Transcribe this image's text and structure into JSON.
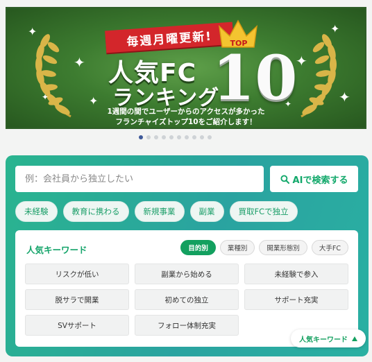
{
  "banner": {
    "ribbon": "毎週月曜更新!",
    "top_label": "TOP",
    "title_line1": "人気FC",
    "title_line2": "ランキング",
    "number": "10",
    "desc_line1": "1週間の間でユーザーからのアクセスが多かった",
    "desc_line2": "フランチャイズトップ10をご紹介します！"
  },
  "carousel": {
    "total": 10,
    "active_index": 0
  },
  "search": {
    "placeholder": "例：会社員から独立したい",
    "button_label": "AIで検索する"
  },
  "quick_tags": [
    "未経験",
    "教育に携わる",
    "新規事業",
    "副業",
    "買取FCで独立"
  ],
  "keywords": {
    "title": "人気キーワード",
    "tabs": [
      {
        "label": "目的別",
        "active": true
      },
      {
        "label": "業種別",
        "active": false
      },
      {
        "label": "開業形態別",
        "active": false
      },
      {
        "label": "大手FC",
        "active": false
      }
    ],
    "items": [
      "リスクが低い",
      "副業から始める",
      "未経験で参入",
      "脱サラで開業",
      "初めての独立",
      "サポート充実",
      "SVサポート",
      "フォロー体制充実"
    ],
    "toggle_label": "人気キーワード",
    "toggle_icon": "triangle-up-icon"
  },
  "colors": {
    "accent": "#13a05f",
    "panel_start": "#2ab48f",
    "panel_end": "#2aa3a0",
    "ribbon": "#d3262b",
    "banner": "#3d7c30"
  }
}
